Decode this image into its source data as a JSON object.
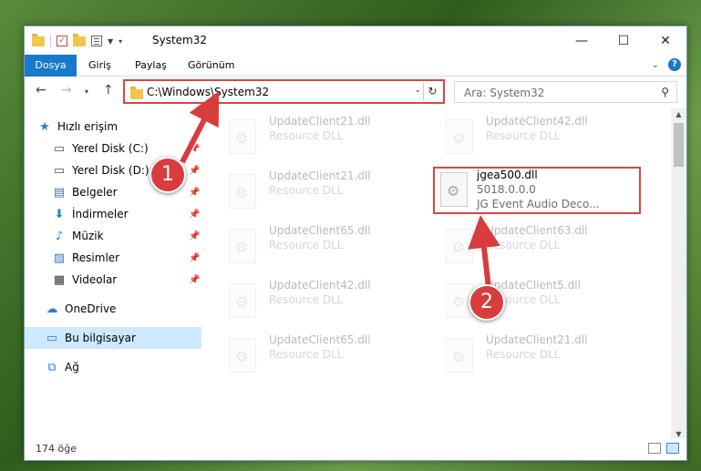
{
  "window": {
    "title": "System32"
  },
  "ribbon": {
    "tabs": [
      "Dosya",
      "Giriş",
      "Paylaş",
      "Görünüm"
    ],
    "help": "?"
  },
  "address": {
    "path": "C:\\Windows\\System32"
  },
  "search": {
    "placeholder": "Ara: System32"
  },
  "sidebar": {
    "items": [
      {
        "label": "Hızlı erişim",
        "icon": "star-icon"
      },
      {
        "label": "Yerel Disk (C:)",
        "icon": "drive-icon",
        "pinned": true
      },
      {
        "label": "Yerel Disk (D:)",
        "icon": "drive-icon",
        "pinned": true
      },
      {
        "label": "Belgeler",
        "icon": "document-icon",
        "pinned": true
      },
      {
        "label": "İndirmeler",
        "icon": "download-icon",
        "pinned": true
      },
      {
        "label": "Müzik",
        "icon": "music-icon",
        "pinned": true
      },
      {
        "label": "Resimler",
        "icon": "pictures-icon",
        "pinned": true
      },
      {
        "label": "Videolar",
        "icon": "video-icon",
        "pinned": true
      },
      {
        "label": "OneDrive",
        "icon": "cloud-icon"
      },
      {
        "label": "Bu bilgisayar",
        "icon": "computer-icon",
        "selected": true
      },
      {
        "label": "Ağ",
        "icon": "network-icon"
      }
    ]
  },
  "files": [
    {
      "name": "UpdateClient21.dll",
      "sub": "Resource DLL"
    },
    {
      "name": "UpdateClient42.dll",
      "sub": "Resource DLL"
    },
    {
      "name": "UpdateClient21.dll",
      "sub": "Resource DLL"
    },
    {
      "name": "jgea500.dll",
      "sub": "5018.0.0.0",
      "sub2": "JG Event Audio Deco...",
      "highlighted": true
    },
    {
      "name": "UpdateClient65.dll",
      "sub": "Resource DLL"
    },
    {
      "name": "UpdateClient63.dll",
      "sub": "Resource DLL"
    },
    {
      "name": "UpdateClient42.dll",
      "sub": "Resource DLL"
    },
    {
      "name": "UpdateClient5.dll",
      "sub": "Resource DLL"
    },
    {
      "name": "UpdateClient65.dll",
      "sub": "Resource DLL"
    },
    {
      "name": "UpdateClient21.dll",
      "sub": "Resource DLL"
    }
  ],
  "status": {
    "count": "174 öğe"
  },
  "annotations": {
    "step1": "1",
    "step2": "2"
  },
  "colors": {
    "accent": "#1979ca",
    "highlight": "#d94646",
    "selected": "#cde8ff"
  }
}
